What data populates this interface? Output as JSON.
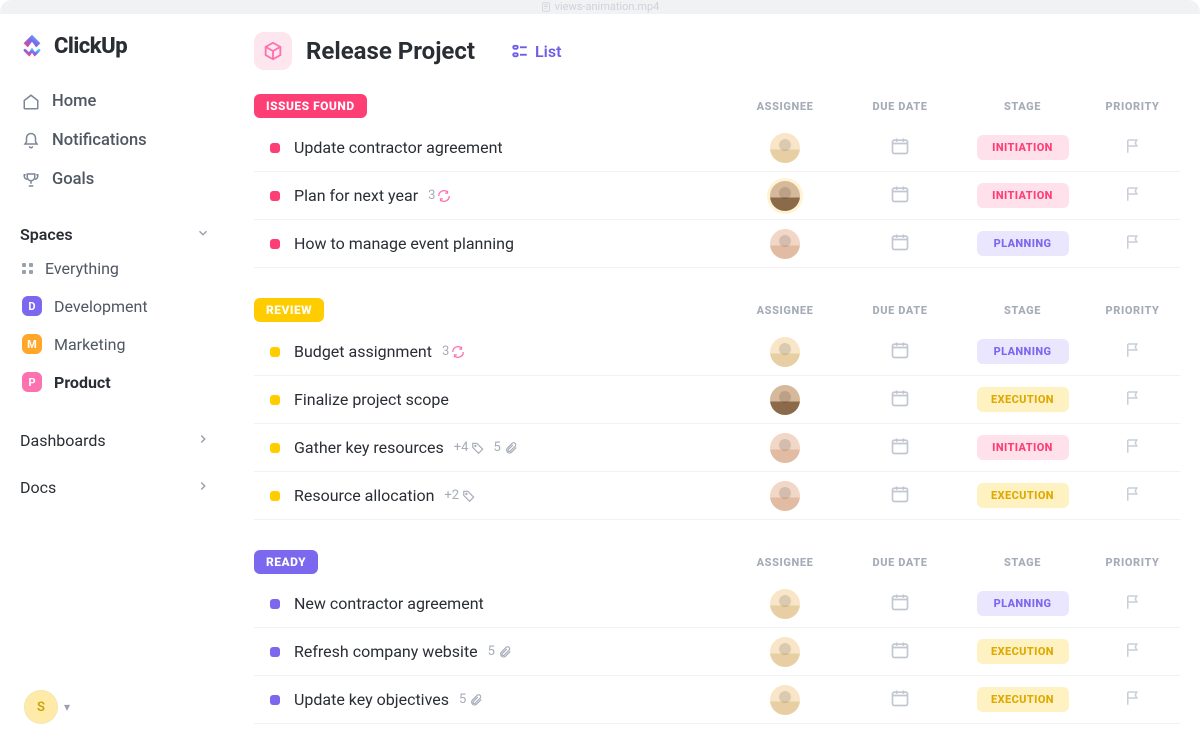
{
  "window_file": "views-animation.mp4",
  "app": {
    "name": "ClickUp"
  },
  "sidebar": {
    "nav": [
      {
        "label": "Home",
        "icon": "home-icon"
      },
      {
        "label": "Notifications",
        "icon": "bell-icon"
      },
      {
        "label": "Goals",
        "icon": "trophy-icon"
      }
    ],
    "spaces_label": "Spaces",
    "everything_label": "Everything",
    "spaces": [
      {
        "letter": "D",
        "label": "Development",
        "color": "purple",
        "active": false
      },
      {
        "letter": "M",
        "label": "Marketing",
        "color": "orange",
        "active": false
      },
      {
        "letter": "P",
        "label": "Product",
        "color": "pink",
        "active": true
      }
    ],
    "dashboards_label": "Dashboards",
    "docs_label": "Docs",
    "footer_avatar_initial": "S"
  },
  "header": {
    "project_title": "Release Project",
    "view_label": "List"
  },
  "columns": {
    "assignee": "ASSIGNEE",
    "due_date": "DUE DATE",
    "stage": "STAGE",
    "priority": "PRIORITY"
  },
  "stages": {
    "initiation": "INITIATION",
    "planning": "PLANNING",
    "execution": "EXECUTION"
  },
  "groups": [
    {
      "name": "ISSUES FOUND",
      "color": "pink",
      "tasks": [
        {
          "title": "Update contractor agreement",
          "assignee": "a1",
          "stage": "initiation"
        },
        {
          "title": "Plan for next year",
          "recurring": 3,
          "assignee": "a2",
          "ring": true,
          "stage": "initiation"
        },
        {
          "title": "How to manage event planning",
          "assignee": "a3",
          "stage": "planning"
        }
      ]
    },
    {
      "name": "REVIEW",
      "color": "yellow",
      "tasks": [
        {
          "title": "Budget assignment",
          "recurring": 3,
          "assignee": "a1",
          "stage": "planning"
        },
        {
          "title": "Finalize project scope",
          "assignee": "a2",
          "stage": "execution"
        },
        {
          "title": "Gather key resources",
          "tags": "+4",
          "attachments": 5,
          "assignee": "a3",
          "stage": "initiation"
        },
        {
          "title": "Resource allocation",
          "tags": "+2",
          "assignee": "a3",
          "stage": "execution"
        }
      ]
    },
    {
      "name": "READY",
      "color": "purple",
      "tasks": [
        {
          "title": "New contractor agreement",
          "assignee": "a1",
          "stage": "planning"
        },
        {
          "title": "Refresh company website",
          "attachments": 5,
          "assignee": "a1",
          "stage": "execution"
        },
        {
          "title": "Update key objectives",
          "attachments": 5,
          "assignee": "a1",
          "stage": "execution"
        }
      ]
    }
  ]
}
